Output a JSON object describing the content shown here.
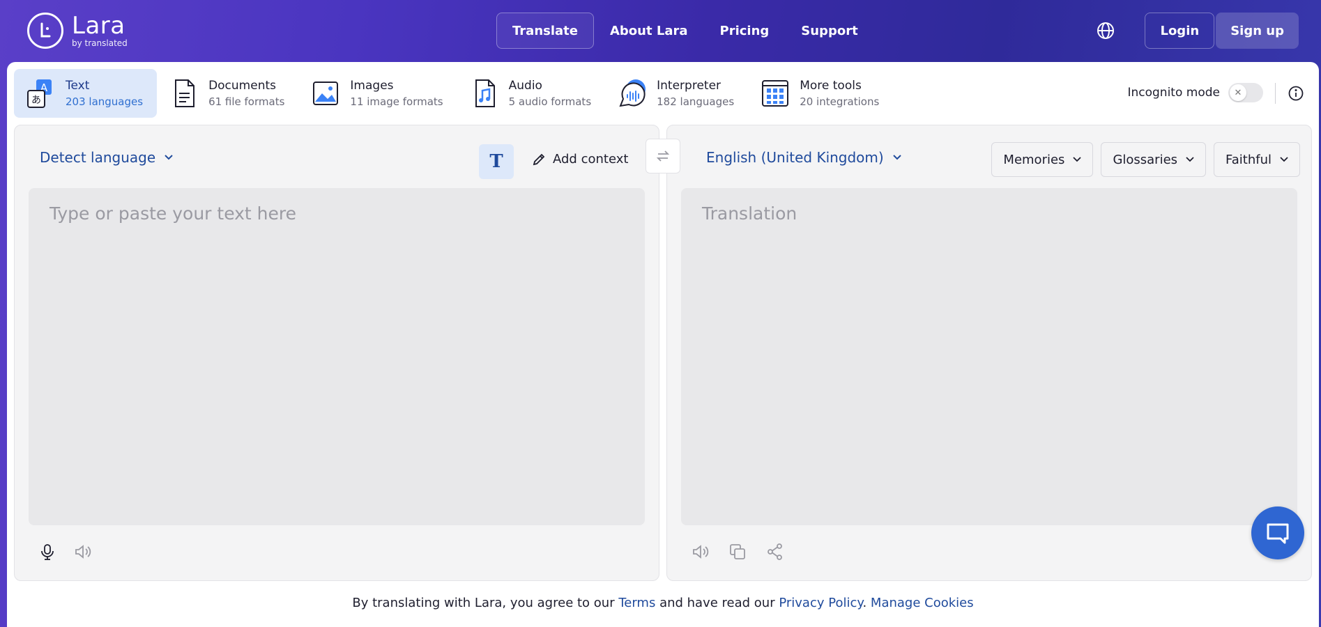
{
  "brand": {
    "name": "Lara",
    "sub": "by translated"
  },
  "nav": {
    "links": [
      "Translate",
      "About Lara",
      "Pricing",
      "Support"
    ],
    "login": "Login",
    "signup": "Sign up"
  },
  "tools": [
    {
      "title": "Text",
      "sub": "203 languages"
    },
    {
      "title": "Documents",
      "sub": "61 file formats"
    },
    {
      "title": "Images",
      "sub": "11 image formats"
    },
    {
      "title": "Audio",
      "sub": "5 audio formats"
    },
    {
      "title": "Interpreter",
      "sub": "182 languages"
    },
    {
      "title": "More tools",
      "sub": "20 integrations"
    }
  ],
  "incognito": {
    "label": "Incognito mode",
    "enabled": false
  },
  "source": {
    "language": "Detect language",
    "placeholder": "Type or paste your text here",
    "add_context": "Add context"
  },
  "target": {
    "language": "English (United Kingdom)",
    "placeholder": "Translation",
    "dropdowns": [
      "Memories",
      "Glossaries",
      "Faithful"
    ]
  },
  "legal": {
    "prefix": "By translating with Lara, you agree to our ",
    "terms": "Terms",
    "middle": " and have read our ",
    "privacy": "Privacy Policy",
    "dot": ".",
    "cookies": "Manage Cookies"
  },
  "colors": {
    "accent": "#1f4a9c",
    "active_tab_bg": "#dde8fa",
    "chat": "#2f66d2"
  }
}
